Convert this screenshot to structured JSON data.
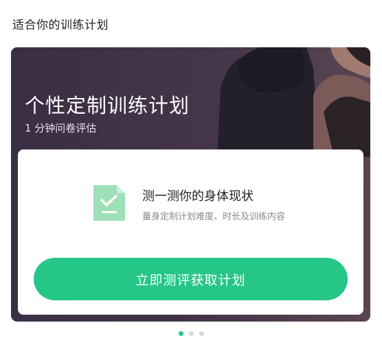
{
  "section": {
    "title": "适合你的训练计划"
  },
  "card": {
    "title": "个性定制训练计划",
    "subtitle": "1 分钟问卷评估",
    "feature_title": "测一测你的身体现状",
    "feature_desc": "量身定制计划难度、时长及训练内容",
    "cta_label": "立即测评获取计划"
  },
  "carousel": {
    "page_count": 3,
    "active_index": 0
  },
  "colors": {
    "accent": "#26c689",
    "card_bg": "#3f3244",
    "dot_inactive": "#d8d8d8"
  }
}
